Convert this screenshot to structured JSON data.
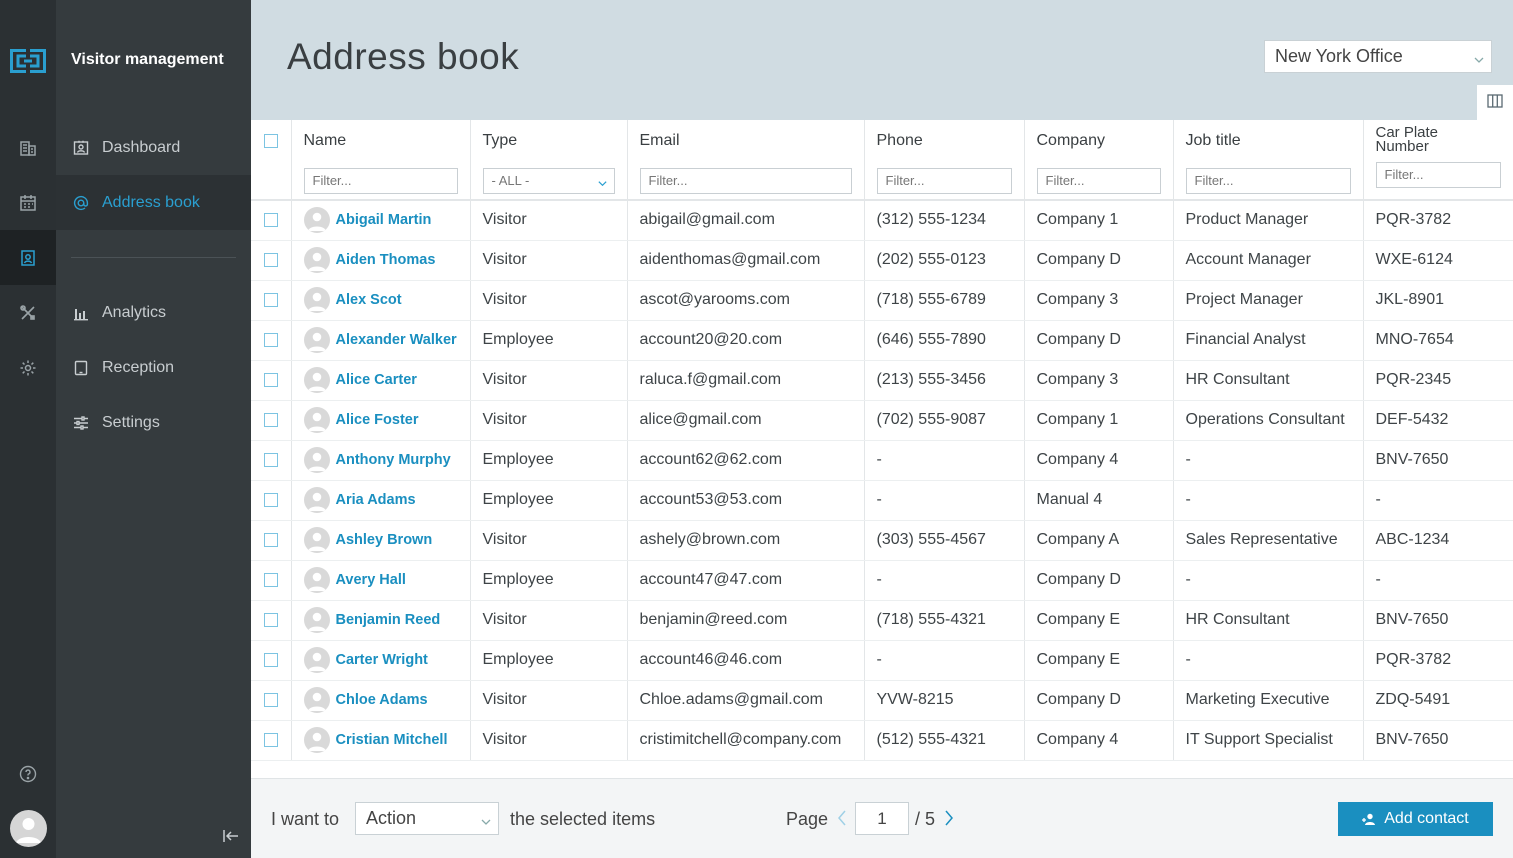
{
  "app": {
    "title": "Visitor management"
  },
  "sidebar": {
    "items": [
      {
        "label": "Dashboard",
        "icon": "contact-card-icon"
      },
      {
        "label": "Address book",
        "icon": "at-icon",
        "active": true
      },
      {
        "label": "Analytics",
        "icon": "bar-chart-icon"
      },
      {
        "label": "Reception",
        "icon": "tablet-icon"
      },
      {
        "label": "Settings",
        "icon": "sliders-icon"
      }
    ]
  },
  "header": {
    "title": "Address book",
    "office": "New York Office"
  },
  "table": {
    "columns": [
      "Name",
      "Type",
      "Email",
      "Phone",
      "Company",
      "Job title",
      "Car Plate Number"
    ],
    "filter_placeholder": "Filter...",
    "type_filter_value": "- ALL -",
    "rows": [
      [
        "Abigail Martin",
        "Visitor",
        "abigail@gmail.com",
        "(312) 555-1234",
        "Company 1",
        "Product Manager",
        "PQR-3782"
      ],
      [
        "Aiden Thomas",
        "Visitor",
        "aidenthomas@gmail.com",
        "(202) 555-0123",
        "Company D",
        "Account Manager",
        "WXE-6124"
      ],
      [
        "Alex Scot",
        "Visitor",
        "ascot@yarooms.com",
        "(718) 555-6789",
        "Company 3",
        "Project Manager",
        "JKL-8901"
      ],
      [
        "Alexander Walker",
        "Employee",
        "account20@20.com",
        "(646) 555-7890",
        "Company D",
        "Financial Analyst",
        "MNO-7654"
      ],
      [
        "Alice Carter",
        "Visitor",
        "raluca.f@gmail.com",
        "(213) 555-3456",
        "Company 3",
        "HR Consultant",
        "PQR-2345"
      ],
      [
        "Alice Foster",
        "Visitor",
        "alice@gmail.com",
        "(702) 555-9087",
        "Company 1",
        "Operations Consultant",
        "DEF-5432"
      ],
      [
        "Anthony Murphy",
        "Employee",
        "account62@62.com",
        "-",
        "Company 4",
        "-",
        "BNV-7650"
      ],
      [
        "Aria Adams",
        "Employee",
        "account53@53.com",
        "-",
        "Manual 4",
        "-",
        "-"
      ],
      [
        "Ashley Brown",
        "Visitor",
        "ashely@brown.com",
        "(303) 555-4567",
        "Company A",
        "Sales Representative",
        "ABC-1234"
      ],
      [
        "Avery Hall",
        "Employee",
        "account47@47.com",
        "-",
        "Company D",
        "-",
        "-"
      ],
      [
        "Benjamin Reed",
        "Visitor",
        "benjamin@reed.com",
        "(718) 555-4321",
        "Company E",
        "HR Consultant",
        "BNV-7650"
      ],
      [
        "Carter Wright",
        "Employee",
        "account46@46.com",
        "-",
        "Company E",
        "-",
        "PQR-3782"
      ],
      [
        "Chloe Adams",
        "Visitor",
        "Chloe.adams@gmail.com",
        "YVW-8215",
        "Company D",
        "Marketing Executive",
        "ZDQ-5491"
      ],
      [
        "Cristian Mitchell",
        "Visitor",
        "cristimitchell@company.com",
        "(512) 555-4321",
        "Company 4",
        "IT Support Specialist",
        "BNV-7650"
      ]
    ]
  },
  "footer": {
    "i_want_to": "I want to",
    "action": "Action",
    "selected_items": "the selected items",
    "page_label": "Page",
    "page_current": "1",
    "page_total": "/ 5",
    "add_contact": "Add contact"
  },
  "colors": {
    "accent": "#1a8fc0",
    "rail": "#2b3033",
    "sidebar": "#353b3e",
    "header": "#d0dce2"
  }
}
